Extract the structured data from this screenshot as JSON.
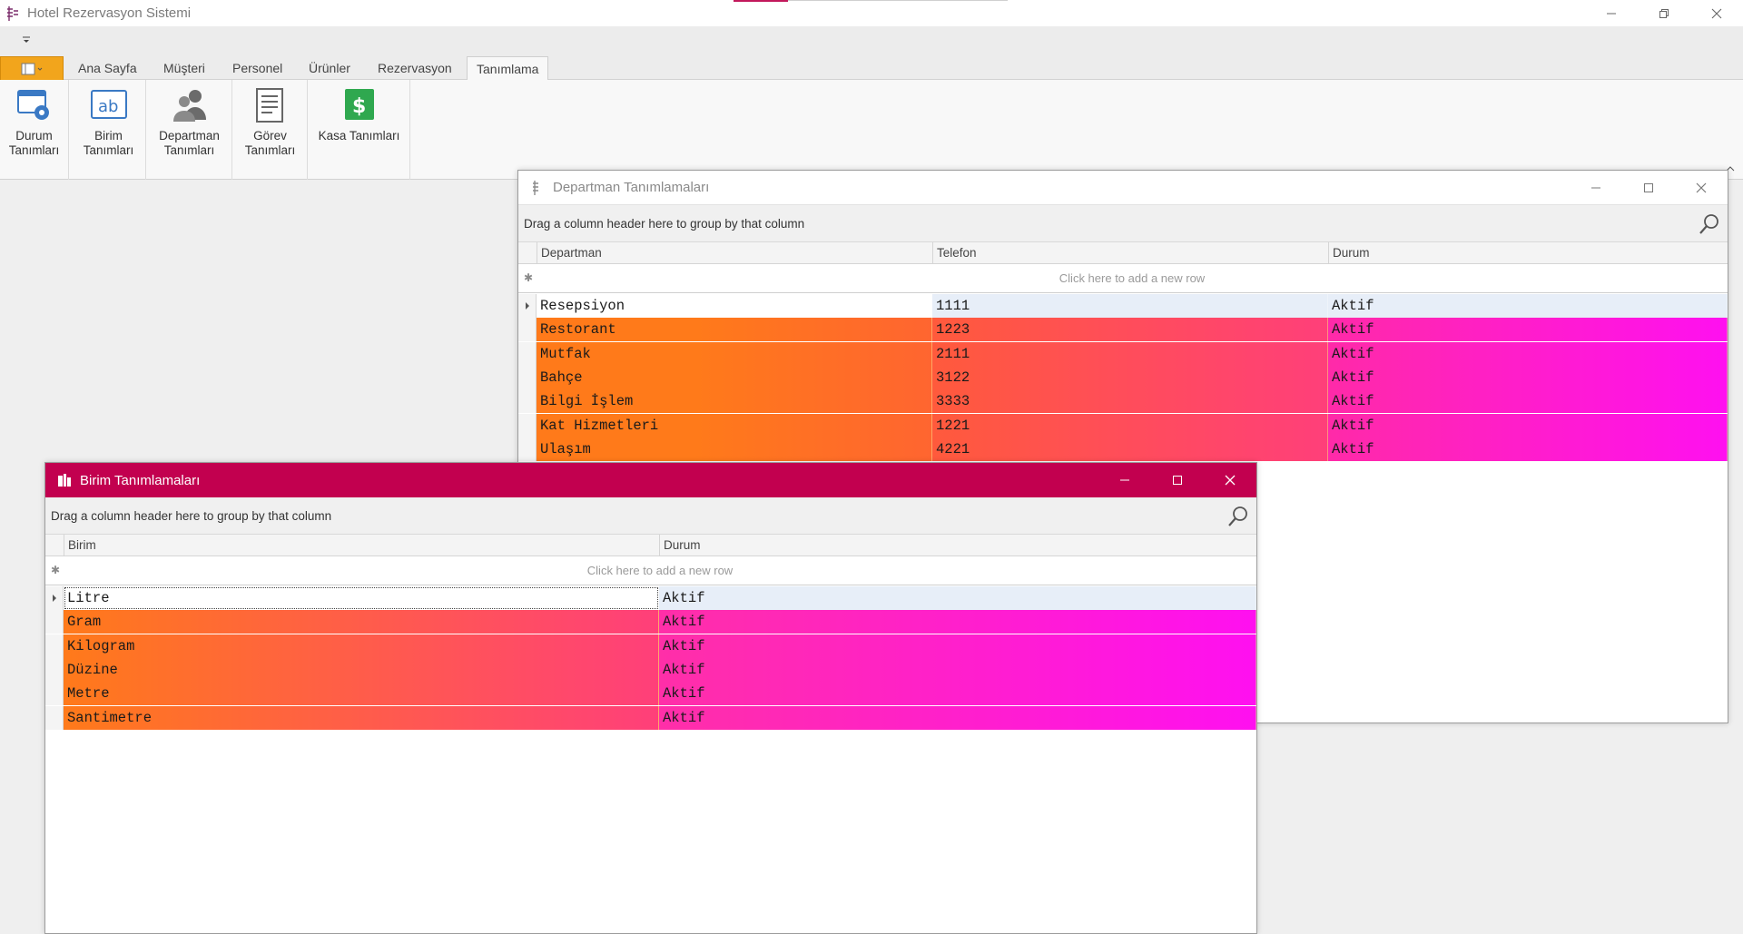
{
  "app": {
    "title": "Hotel Rezervasyon Sistemi"
  },
  "tabs": [
    {
      "label": "Ana Sayfa"
    },
    {
      "label": "Müşteri"
    },
    {
      "label": "Personel"
    },
    {
      "label": "Ürünler"
    },
    {
      "label": "Rezervasyon"
    },
    {
      "label": "Tanımlama",
      "active": true
    }
  ],
  "ribbon": {
    "buttons": [
      {
        "label": "Durum\nTanımları",
        "icon": "status-settings-icon"
      },
      {
        "label": "Birim\nTanımları",
        "icon": "unit-ab-icon"
      },
      {
        "label": "Departman\nTanımları",
        "icon": "department-users-icon"
      },
      {
        "label": "Görev\nTanımları",
        "icon": "task-list-icon"
      },
      {
        "label": "Kasa Tanımları",
        "icon": "cash-dollar-icon"
      }
    ]
  },
  "departman_window": {
    "title": "Departman Tanımlamaları",
    "group_hint": "Drag a column header here to group by that column",
    "new_row_hint": "Click here to add a new row",
    "columns": [
      "Departman",
      "Telefon",
      "Durum"
    ],
    "rows": [
      [
        "Resepsiyon",
        "1111",
        "Aktif"
      ],
      [
        "Restorant",
        "1223",
        "Aktif"
      ],
      [
        "Mutfak",
        "2111",
        "Aktif"
      ],
      [
        "Bahçe",
        "3122",
        "Aktif"
      ],
      [
        "Bilgi İşlem",
        "3333",
        "Aktif"
      ],
      [
        "Kat Hizmetleri",
        "1221",
        "Aktif"
      ],
      [
        "Ulaşım",
        "4221",
        "Aktif"
      ]
    ]
  },
  "birim_window": {
    "title": "Birim Tanımlamaları",
    "group_hint": "Drag a column header here to group by that column",
    "new_row_hint": "Click here to add a new row",
    "columns": [
      "Birim",
      "Durum"
    ],
    "rows": [
      [
        "Litre",
        "Aktif"
      ],
      [
        "Gram",
        "Aktif"
      ],
      [
        "Kilogram",
        "Aktif"
      ],
      [
        "Düzine",
        "Aktif"
      ],
      [
        "Metre",
        "Aktif"
      ],
      [
        "Santimetre",
        "Aktif"
      ]
    ]
  },
  "colors": {
    "accent": "#c2185b",
    "file_tab": "#f2a51c",
    "gradient_start": "#ff7a1a",
    "gradient_mid": "#ff3f7a",
    "gradient_end": "#ff10f0",
    "selected_row": "#e7eef8"
  }
}
